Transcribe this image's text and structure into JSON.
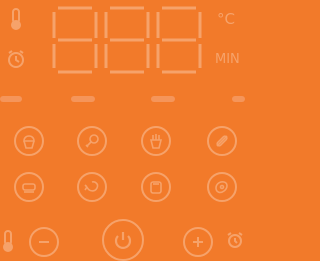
{
  "display": {
    "digits": [
      "8",
      "8",
      "8"
    ],
    "temp_unit": "°C",
    "time_unit": "MIN"
  },
  "icons": {
    "row1": [
      "cupcake-icon",
      "drumstick-icon",
      "fries-icon",
      "sausage-icon"
    ],
    "row2": [
      "dish-icon",
      "shrimp-icon",
      "toast-icon",
      "steak-icon"
    ],
    "bottom": [
      "thermometer-icon",
      "minus-icon",
      "power-icon",
      "plus-icon",
      "alarm-clock-icon"
    ]
  },
  "colors": {
    "background": "#f27a2a",
    "foreground": "#f6a26a"
  }
}
